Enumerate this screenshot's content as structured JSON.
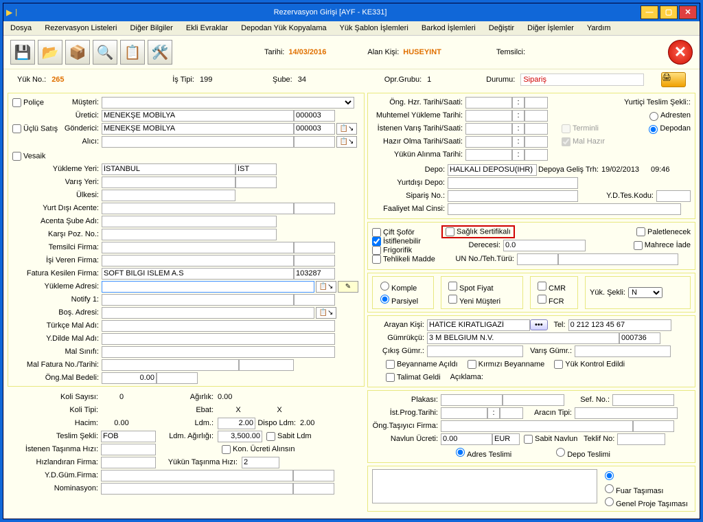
{
  "title": "Rezervasyon Girişi [AYF - KE331]",
  "menu": [
    "Dosya",
    "Rezervasyon Listeleri",
    "Diğer Bilgiler",
    "Ekli Evraklar",
    "Depodan Yük Kopyalama",
    "Yük Şablon İşlemleri",
    "Barkod İşlemleri",
    "Değiştir",
    "Diğer İşlemler",
    "Yardım"
  ],
  "header": {
    "tarih_lbl": "Tarihi:",
    "tarih": "14/03/2016",
    "alan_lbl": "Alan Kişi:",
    "alan": "HUSEYINT",
    "temsilci_lbl": "Temsilci:"
  },
  "info": {
    "yuk_lbl": "Yük No.:",
    "yuk": "265",
    "istipi_lbl": "İş Tipi:",
    "istipi": "199",
    "sube_lbl": "Şube:",
    "sube": "34",
    "opr_lbl": "Opr.Grubu:",
    "opr": "1",
    "durum_lbl": "Durumu:",
    "durum": "Sipariş"
  },
  "left": {
    "police": "Poliçe",
    "uclu": "Üçlü Satış",
    "vesaik": "Vesaik",
    "musteri_lbl": "Müşteri:",
    "uretici_lbl": "Üretici:",
    "uretici": "MENEKŞE MOBİLYA",
    "uretici_code": "000003",
    "gonderici_lbl": "Gönderici:",
    "gonderici": "MENEKŞE MOBİLYA",
    "gonderici_code": "000003",
    "alici_lbl": "Alıcı:",
    "yyeri_lbl": "Yükleme Yeri:",
    "yyeri": "İSTANBUL",
    "yyeri_code": "İST",
    "vyeri_lbl": "Varış Yeri:",
    "ulke_lbl": "Ülkesi:",
    "ydacente_lbl": "Yurt Dışı Acente:",
    "acentasube_lbl": "Acenta Şube Adı:",
    "karsipoz_lbl": "Karşı Poz. No.:",
    "temsilci_lbl": "Temsilci Firma:",
    "isveren_lbl": "İşi Veren Firma:",
    "fatura_lbl": "Fatura Kesilen Firma:",
    "fatura": "SOFT BILGI ISLEM A.S",
    "fatura_code": "103287",
    "yadres_lbl": "Yükleme Adresi:",
    "notify_lbl": "Notify 1:",
    "bosadres_lbl": "Boş. Adresi:",
    "turkcemal_lbl": "Türkçe Mal Adı:",
    "ydilmal_lbl": "Y.Dilde Mal Adı:",
    "malsinif_lbl": "Mal Sınıfı:",
    "malfatura_lbl": "Mal Fatura No./Tarihi:",
    "onmal_lbl": "Öng.Mal Bedeli:",
    "onmal": "0.00",
    "koli_lbl": "Koli Sayısı:",
    "koli": "0",
    "agirlik_lbl": "Ağırlık:",
    "agirlik": "0.00",
    "kolitipi_lbl": "Koli Tipi:",
    "ebat_lbl": "Ebat:",
    "x": "X",
    "hacim_lbl": "Hacim:",
    "hacim": "0.00",
    "ldm_lbl": "Ldm.:",
    "ldm": "2.00",
    "displdm_lbl": "Dispo Ldm:",
    "displdm": "2.00",
    "teslim_lbl": "Teslim Şekli:",
    "teslim": "FOB",
    "ldmag_lbl": "Ldm. Ağırlığı:",
    "ldmag": "3,500.00",
    "sabitldm": "Sabit Ldm",
    "isttasima_lbl": "İstenen Taşınma Hızı:",
    "konucreti": "Kon. Ücreti Alınsın",
    "hizfirma_lbl": "Hızlandıran Firma:",
    "yukuntasima_lbl": "Yükün Taşınma Hızı:",
    "yukuntasima": "2",
    "ydgumfirma_lbl": "Y.D.Güm.Firma:",
    "nominasyon_lbl": "Nominasyon:"
  },
  "right": {
    "onghzr_lbl": "Öng. Hzr. Tarihi/Saati:",
    "muhyuk_lbl": "Muhtemel Yükleme Tarihi:",
    "istvar_lbl": "İstenen Varış Tarihi/Saati:",
    "hazir_lbl": "Hazır Olma Tarihi/Saati:",
    "yukalin_lbl": "Yükün Alınma Tarihi:",
    "yurtici_lbl": "Yurtiçi Teslim Şekli::",
    "adresten": "Adresten",
    "depodan": "Depodan",
    "terminli": "Terminli",
    "malhazir": "Mal Hazır",
    "depo_lbl": "Depo:",
    "depo": "HALKALI DEPOSU(IHR)",
    "depogelist_lbl": "Depoya Geliş Trh:",
    "depogelist": "19/02/2013",
    "deposaat": "09:46",
    "ydepo_lbl": "Yurtdışı Depo:",
    "siparis_lbl": "Sipariş No.:",
    "ydteskod_lbl": "Y.D.Tes.Kodu:",
    "faalmal_lbl": "Faaliyet Mal Cinsi:",
    "cift": "Çift Şoför",
    "istif": "İstiflenebilir",
    "frigo": "Frigorifik",
    "tehlike": "Tehlikeli Madde",
    "saglik": "Sağlık Sertifikalı",
    "palet": "Paletlenecek",
    "mahrece": "Mahrece İade",
    "derece_lbl": "Derecesi:",
    "derece": "0.0",
    "unno_lbl": "UN No./Teh.Türü:",
    "komple": "Komple",
    "parsiyel": "Parsiyel",
    "spot": "Spot Fiyat",
    "yenimusteri": "Yeni Müşteri",
    "cmr": "CMR",
    "fcr": "FCR",
    "yuksekli_lbl": "Yük. Şekli:",
    "yuksekli": "N",
    "arayan_lbl": "Arayan Kişi:",
    "arayan": "HATİCE KIRATLIGAZİ",
    "tel_lbl": "Tel:",
    "tel": "0 212 123 45 67",
    "gumrukcu_lbl": "Gümrükçü:",
    "gumrukcu": "3 M BELGIUM N.V.",
    "gumrukcu_code": "000736",
    "cikisgumr_lbl": "Çıkış Gümr.:",
    "varisgumr_lbl": "Varış Gümr.:",
    "beyanname": "Beyanname Açıldı",
    "kirmizi": "Kırmızı Beyanname",
    "yukkontrol": "Yük Kontrol Edildi",
    "talimat": "Talimat Geldi",
    "aciklama_lbl": "Açıklama:",
    "plakasi_lbl": "Plakası:",
    "sefno_lbl": "Sef. No.:",
    "istprog_lbl": "İst.Prog.Tarihi:",
    "aractipi_lbl": "Aracın Tipi:",
    "ongtas_lbl": "Öng.Taşıyıcı Firma:",
    "navlun_lbl": "Navlun Ücreti:",
    "navlun": "0.00",
    "navlun_cur": "EUR",
    "sabitnavlun": "Sabit Navlun",
    "teklif_lbl": "Teklif No:",
    "adresteslim": "Adres Teslimi",
    "depoteslim": "Depo Teslimi",
    "fuar": "Fuar Taşıması",
    "genelproje": "Genel Proje Taşıması"
  }
}
